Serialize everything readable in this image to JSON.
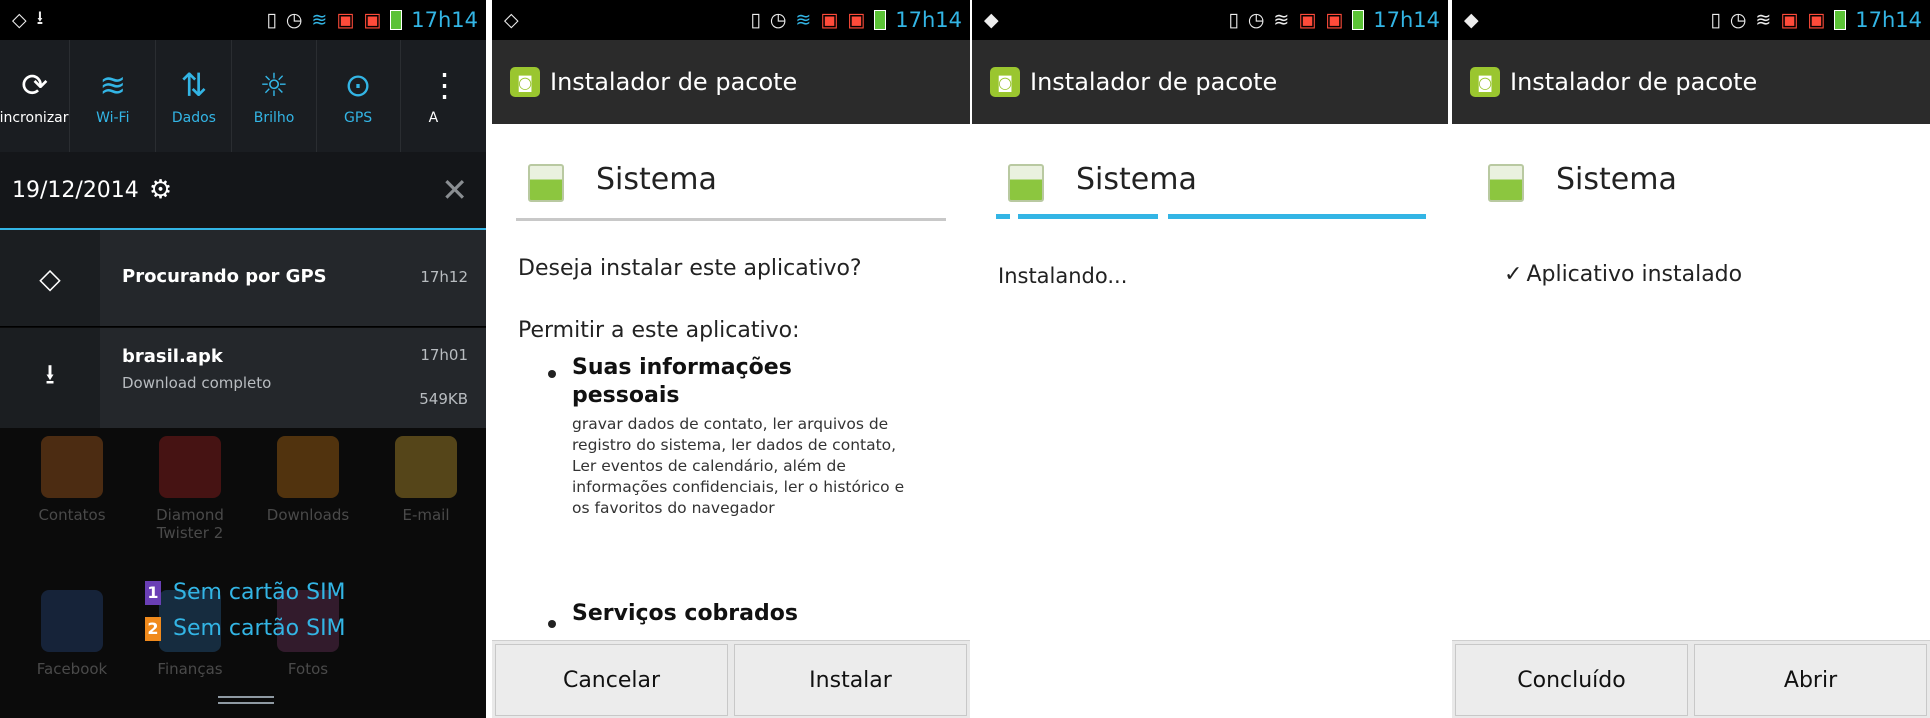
{
  "status": {
    "time": "17h14"
  },
  "notifications": {
    "quick_settings": [
      {
        "icon": "sync-icon",
        "label": "Sincronizar",
        "active": false
      },
      {
        "icon": "wifi-icon",
        "label": "Wi-Fi",
        "active": true
      },
      {
        "icon": "data-icon",
        "label": "Dados",
        "active": true
      },
      {
        "icon": "brightness-icon",
        "label": "Brilho",
        "active": true
      },
      {
        "icon": "gps-icon",
        "label": "GPS",
        "active": true
      },
      {
        "icon": "more-icon",
        "label": "A",
        "active": false
      }
    ],
    "date": "19/12/2014",
    "items": [
      {
        "title": "Procurando por GPS",
        "time": "17h12"
      },
      {
        "title": "brasil.apk",
        "subtitle": "Download completo",
        "time": "17h01",
        "size": "549KB"
      }
    ],
    "home_apps": [
      "Contatos",
      "Diamond Twister 2",
      "Downloads",
      "E-mail",
      "Facebook",
      "Finanças",
      "Fotos"
    ],
    "sim_status": [
      {
        "slot": "1",
        "text": "Sem cartão SIM",
        "color": "#6a3fb5"
      },
      {
        "slot": "2",
        "text": "Sem cartão SIM",
        "color": "#f08a1c"
      }
    ]
  },
  "installer": {
    "app_bar_title": "Instalador de pacote",
    "app_name": "Sistema",
    "screen2": {
      "question": "Deseja instalar este aplicativo?",
      "permissions_intro": "Permitir a este aplicativo:",
      "perm1_title": "Suas informações pessoais",
      "perm1_desc": "gravar dados de contato, ler arquivos de registro do sistema, ler dados de contato, Ler eventos de calendário, além de informações confidenciais, ler o histórico e os favoritos do navegador",
      "perm2_title": "Serviços cobrados",
      "cancel_label": "Cancelar",
      "install_label": "Instalar"
    },
    "screen3": {
      "status": "Instalando..."
    },
    "screen4": {
      "status": "Aplicativo instalado",
      "done_label": "Concluído",
      "open_label": "Abrir"
    }
  }
}
